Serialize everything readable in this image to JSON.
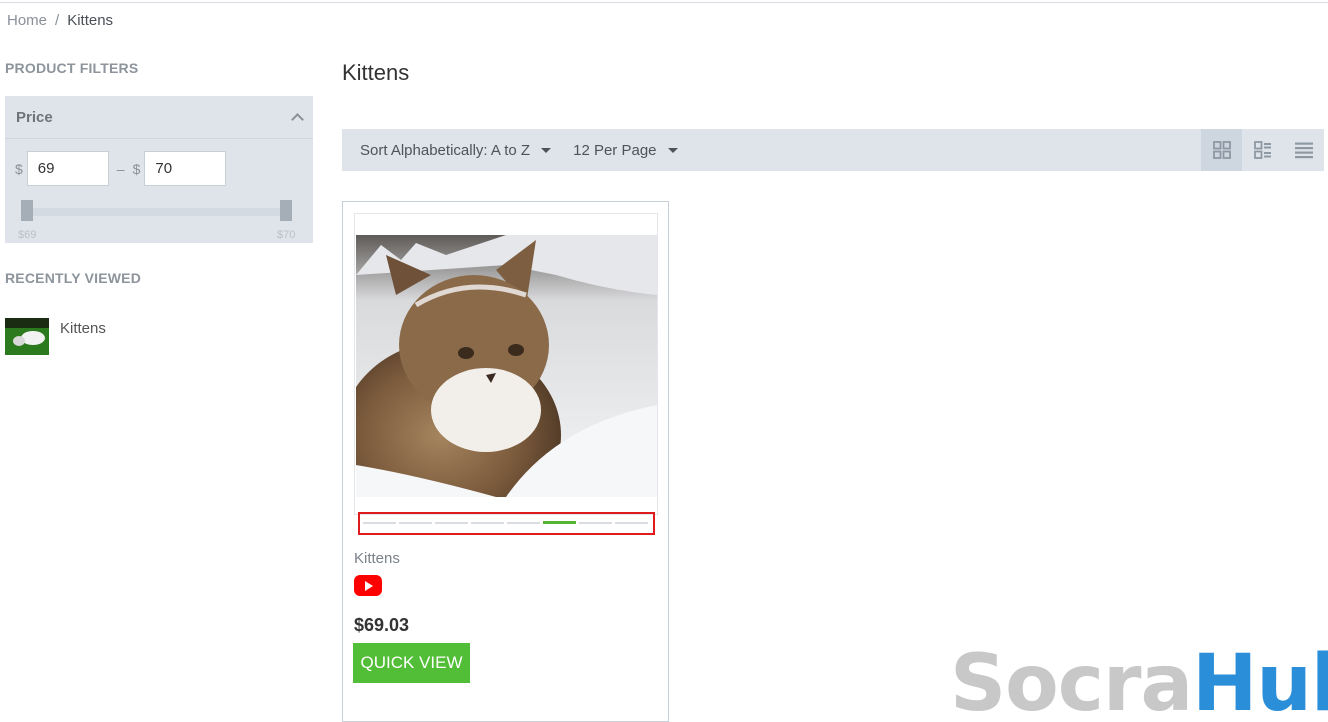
{
  "breadcrumb": {
    "home": "Home",
    "separator": "/",
    "current": "Kittens"
  },
  "sidebar": {
    "filters_title": "PRODUCT FILTERS",
    "price": {
      "label": "Price",
      "currency": "$",
      "dash": "–",
      "min_value": "69",
      "max_value": "70",
      "slider_min_label": "$69",
      "slider_max_label": "$70"
    },
    "recent_title": "RECENTLY VIEWED",
    "recent_items": [
      {
        "name": "Kittens"
      }
    ]
  },
  "main": {
    "title": "Kittens",
    "toolbar": {
      "sort_label": "Sort Alphabetically: A to Z",
      "per_page_label": "12 Per Page",
      "views": [
        "grid-view-icon",
        "list-grid-view-icon",
        "list-view-icon"
      ]
    },
    "product": {
      "name": "Kittens",
      "price": "$69.03",
      "quick_view_label": "QUICK VIEW",
      "carousel_dots": 8,
      "carousel_active_index": 5
    }
  },
  "watermark": {
    "part1": "Socra",
    "part2": "Hub"
  },
  "colors": {
    "accent_green": "#52bd36",
    "highlight_red": "#e01b1b",
    "youtube_red": "#ff0000",
    "panel_bg": "#dfe4ea"
  }
}
